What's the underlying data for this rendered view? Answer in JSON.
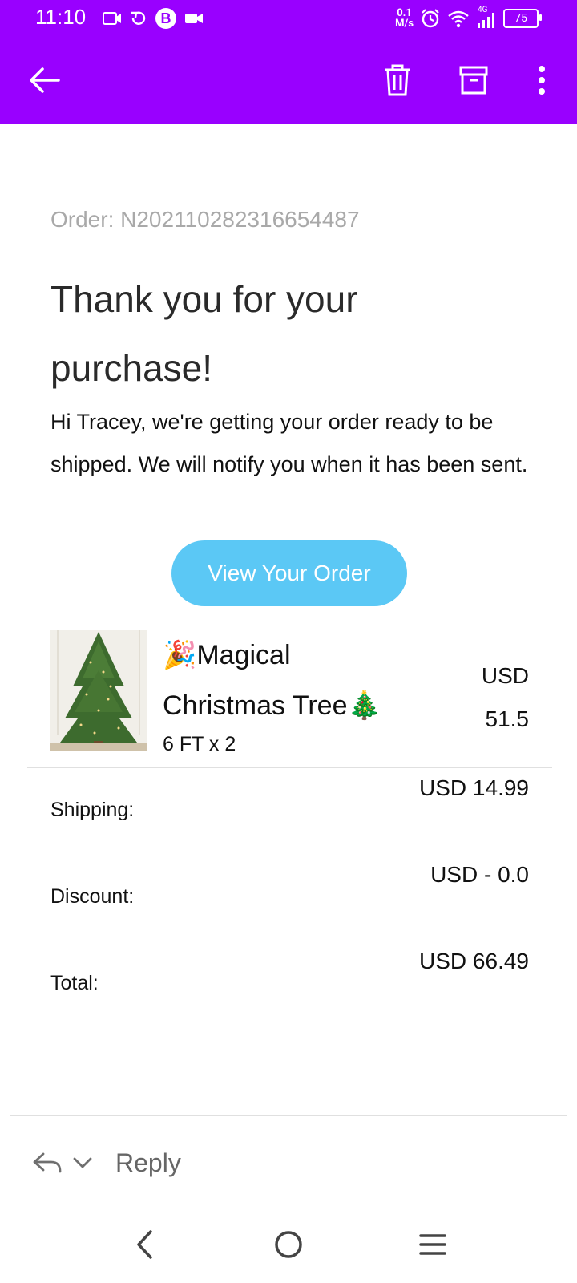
{
  "status_bar": {
    "time": "11:10",
    "net_speed_value": "0.1",
    "net_speed_unit": "M/s",
    "network_label": "4G",
    "battery": "75",
    "notification_badge": "B"
  },
  "app_bar": {
    "back_icon": "arrow-left-icon",
    "delete_icon": "trash-icon",
    "archive_icon": "archive-icon",
    "more_icon": "more-vertical-icon"
  },
  "email": {
    "order_id": "Order: N202110282316654487",
    "heading": "Thank you for your purchase!",
    "message": "Hi Tracey, we're getting your order ready to be shipped. We will notify you when it has been sent.",
    "view_order_button": "View Your Order",
    "product": {
      "name": "🎉Magical Christmas Tree🎄",
      "variant": "6 FT x 2",
      "price": "USD 51.5"
    },
    "summary": [
      {
        "label": "Shipping:",
        "value": "USD 14.99"
      },
      {
        "label": "Discount:",
        "value": "USD - 0.0"
      },
      {
        "label": "Total:",
        "value": "USD 66.49"
      }
    ]
  },
  "reply_bar": {
    "reply_label": "Reply"
  },
  "colors": {
    "app_bar": "#9900ff",
    "button": "#5bc8f5"
  }
}
